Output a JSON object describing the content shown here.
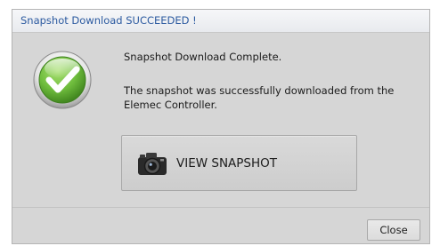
{
  "dialog": {
    "title": "Snapshot Download SUCCEEDED !",
    "status_icon": "success-checkmark-icon",
    "message_heading": "Snapshot Download Complete.",
    "message_body": "The snapshot was successfully downloaded from the Elemec Controller.",
    "view_button": {
      "label": "VIEW SNAPSHOT",
      "icon": "camera-icon"
    },
    "close_button": {
      "label": "Close"
    }
  },
  "colors": {
    "title_text": "#2c5aa0",
    "dialog_background": "#d6d6d6",
    "check_green": "#6fbd3d"
  }
}
